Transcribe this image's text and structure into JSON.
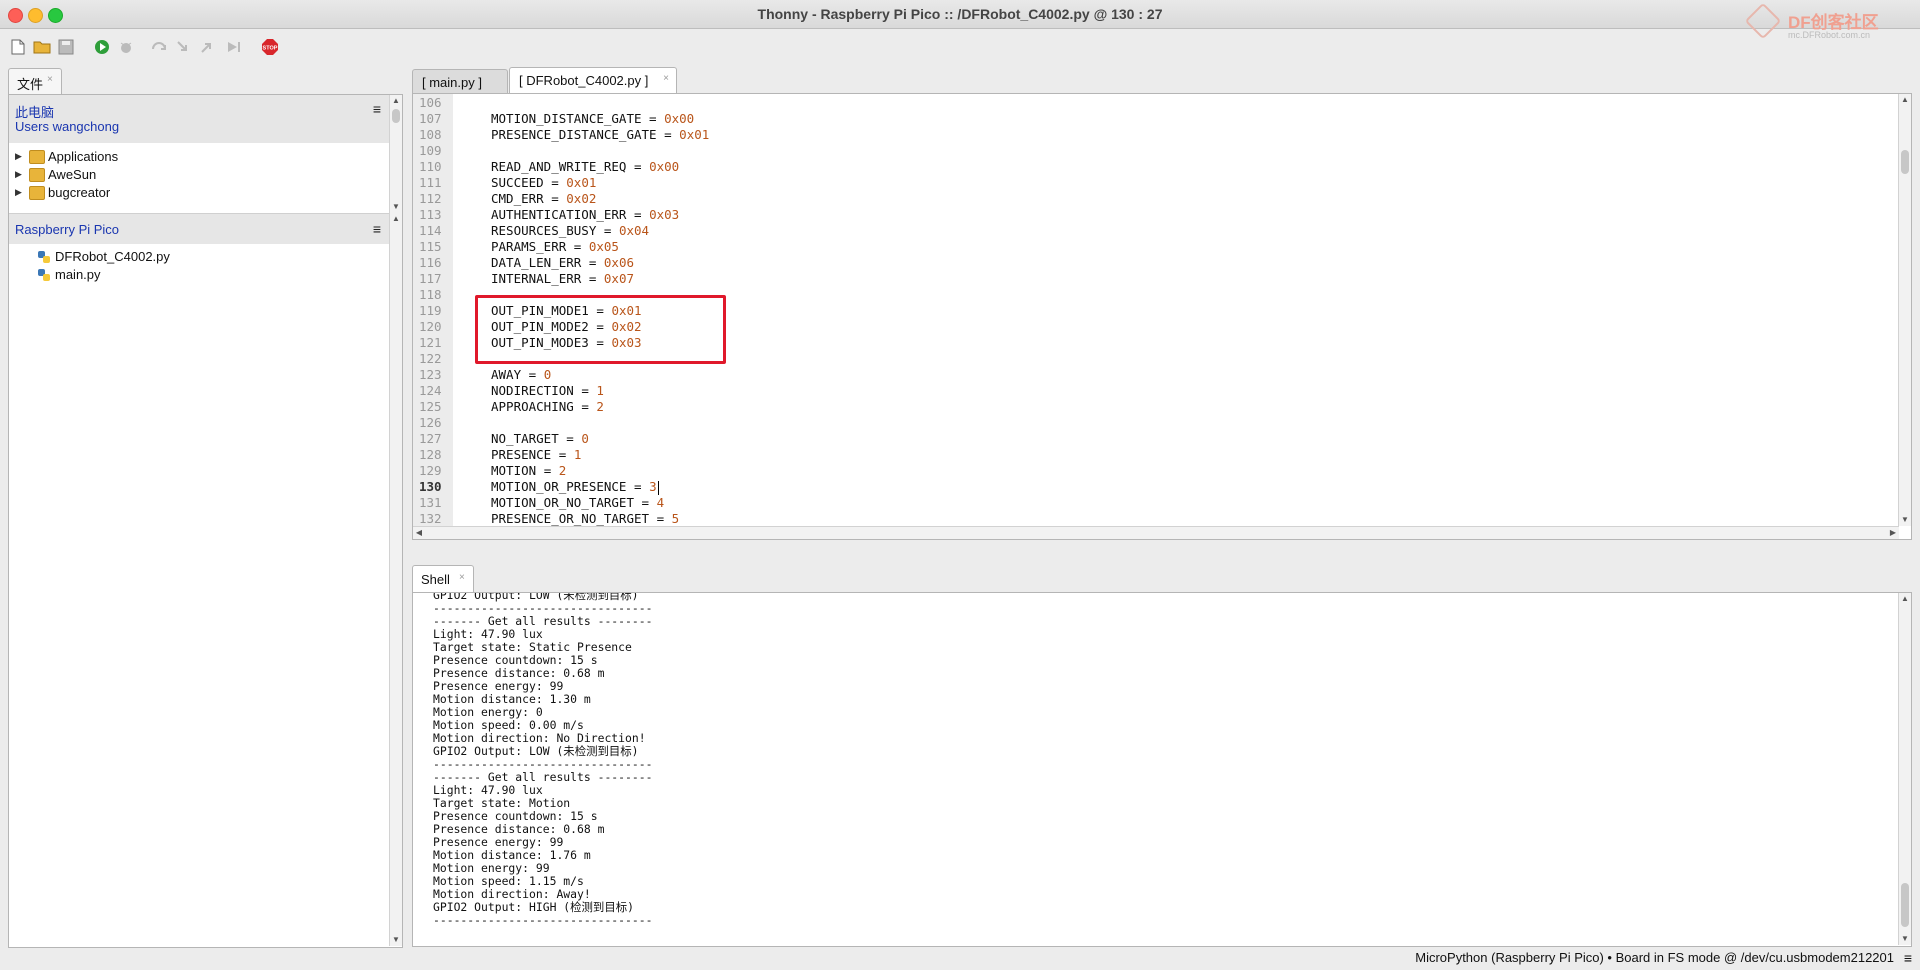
{
  "window": {
    "title": "Thonny  -  Raspberry Pi Pico :: /DFRobot_C4002.py  @  130 : 27"
  },
  "watermark": {
    "brand": "DF创客社区",
    "sub": "mc.DFRobot.com.cn"
  },
  "toolbar": {
    "buttons": [
      "new-file",
      "open-file",
      "save-file",
      "run",
      "debug",
      "step-over",
      "step-into",
      "step-out",
      "resume",
      "stop"
    ],
    "stop_label": "STOP"
  },
  "files_panel": {
    "tab_label": "文件",
    "tab_close": "×",
    "computer": {
      "title": "此电脑",
      "path_sep": "/",
      "path": [
        "Users",
        "wangchong"
      ],
      "items": [
        "Applications",
        "AweSun",
        "bugcreator"
      ]
    },
    "device": {
      "title": "Raspberry Pi Pico",
      "files": [
        "DFRobot_C4002.py",
        "main.py"
      ]
    },
    "menu_glyph": "≡"
  },
  "editor": {
    "tabs": [
      {
        "label": "[ main.py ]",
        "active": false
      },
      {
        "label": "[ DFRobot_C4002.py ]",
        "active": true
      }
    ],
    "current_line": 130,
    "lines": [
      {
        "n": "106",
        "name": "",
        "val": ""
      },
      {
        "n": "107",
        "name": "MOTION_DISTANCE_GATE",
        "val": "0x00"
      },
      {
        "n": "108",
        "name": "PRESENCE_DISTANCE_GATE",
        "val": "0x01"
      },
      {
        "n": "109",
        "name": "",
        "val": ""
      },
      {
        "n": "110",
        "name": "READ_AND_WRITE_REQ",
        "val": "0x00"
      },
      {
        "n": "111",
        "name": "SUCCEED",
        "val": "0x01"
      },
      {
        "n": "112",
        "name": "CMD_ERR",
        "val": "0x02"
      },
      {
        "n": "113",
        "name": "AUTHENTICATION_ERR",
        "val": "0x03"
      },
      {
        "n": "114",
        "name": "RESOURCES_BUSY",
        "val": "0x04"
      },
      {
        "n": "115",
        "name": "PARAMS_ERR",
        "val": "0x05"
      },
      {
        "n": "116",
        "name": "DATA_LEN_ERR",
        "val": "0x06"
      },
      {
        "n": "117",
        "name": "INTERNAL_ERR",
        "val": "0x07"
      },
      {
        "n": "118",
        "name": "",
        "val": ""
      },
      {
        "n": "119",
        "name": "OUT_PIN_MODE1",
        "val": "0x01"
      },
      {
        "n": "120",
        "name": "OUT_PIN_MODE2",
        "val": "0x02"
      },
      {
        "n": "121",
        "name": "OUT_PIN_MODE3",
        "val": "0x03"
      },
      {
        "n": "122",
        "name": "",
        "val": ""
      },
      {
        "n": "123",
        "name": "AWAY",
        "val": "0"
      },
      {
        "n": "124",
        "name": "NODIRECTION",
        "val": "1"
      },
      {
        "n": "125",
        "name": "APPROACHING",
        "val": "2"
      },
      {
        "n": "126",
        "name": "",
        "val": ""
      },
      {
        "n": "127",
        "name": "NO_TARGET",
        "val": "0"
      },
      {
        "n": "128",
        "name": "PRESENCE",
        "val": "1"
      },
      {
        "n": "129",
        "name": "MOTION",
        "val": "2"
      },
      {
        "n": "130",
        "name": "MOTION_OR_PRESENCE",
        "val": "3"
      },
      {
        "n": "131",
        "name": "MOTION_OR_NO_TARGET",
        "val": "4"
      },
      {
        "n": "132",
        "name": "PRESENCE_OR_NO_TARGET",
        "val": "5"
      }
    ],
    "operator": "="
  },
  "shell": {
    "tab_label": "Shell",
    "tab_close": "×",
    "lines": [
      "GPIO2 Output: LOW (未检测到目标)",
      "--------------------------------",
      "------- Get all results --------",
      "Light: 47.90 lux",
      "Target state: Static Presence",
      "Presence countdown: 15 s",
      "Presence distance: 0.68 m",
      "Presence energy: 99",
      "Motion distance: 1.30 m",
      "Motion energy: 0",
      "Motion speed: 0.00 m/s",
      "Motion direction: No Direction!",
      "GPIO2 Output: LOW (未检测到目标)",
      "--------------------------------",
      "------- Get all results --------",
      "Light: 47.90 lux",
      "Target state: Motion",
      "Presence countdown: 15 s",
      "Presence distance: 0.68 m",
      "Presence energy: 99",
      "Motion distance: 1.76 m",
      "Motion energy: 99",
      "Motion speed: 1.15 m/s",
      "Motion direction: Away!",
      "GPIO2 Output: HIGH (检测到目标)",
      "--------------------------------"
    ]
  },
  "status_bar": {
    "text": "MicroPython (Raspberry Pi Pico)  •  Board in FS mode @ /dev/cu.usbmodem212201",
    "menu_glyph": "≡"
  },
  "colors": {
    "number": "#b9551a",
    "highlight_box": "#e0182b",
    "path_link": "#1a36b0"
  }
}
